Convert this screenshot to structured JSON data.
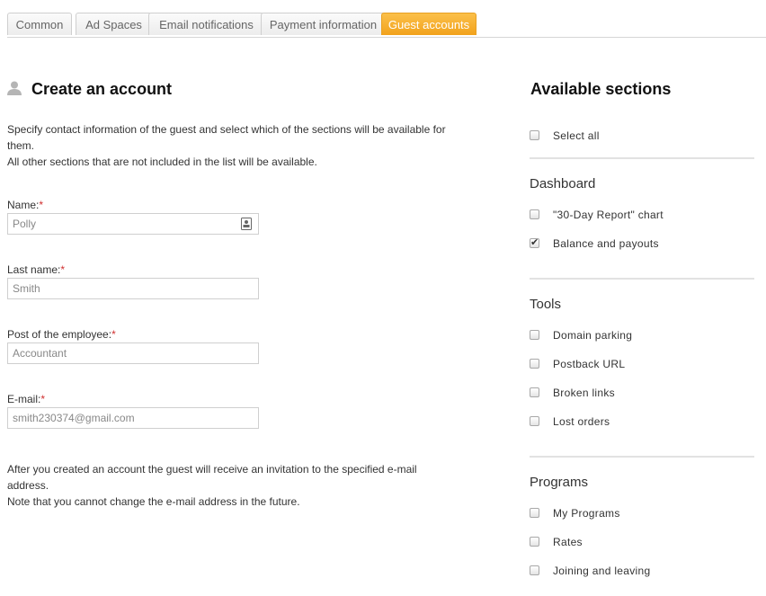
{
  "tabs": [
    {
      "label": "Common"
    },
    {
      "label": "Ad Spaces"
    },
    {
      "label": "Email notifications"
    },
    {
      "label": "Payment information"
    },
    {
      "label": "Guest accounts"
    }
  ],
  "active_tab": "Guest accounts",
  "create": {
    "title": "Create an account",
    "description_line1": "Specify contact information of the guest and select which of the sections will be available for them.",
    "description_line2": "All other sections that are not included in the list will be available."
  },
  "form": {
    "name_label": "Name:",
    "name_value": "Polly",
    "last_name_label": "Last name:",
    "last_name_value": "Smith",
    "post_label": "Post of the employee:",
    "post_value": "Accountant",
    "email_label": "E-mail:",
    "email_value": "smith230374@gmail.com",
    "required_mark": "*"
  },
  "note": {
    "line1": "After you created an account the guest will receive an invitation to the specified e-mail address.",
    "line2": "Note that you cannot change the e-mail address in the future."
  },
  "sections": {
    "title": "Available sections",
    "select_all": {
      "label": "Select all",
      "checked": false
    },
    "dashboard": {
      "title": "Dashboard",
      "items": [
        {
          "label": "\"30-Day Report\" chart",
          "checked": false
        },
        {
          "label": "Balance and payouts",
          "checked": true
        }
      ]
    },
    "tools": {
      "title": "Tools",
      "items": [
        {
          "label": "Domain parking",
          "checked": false
        },
        {
          "label": "Postback URL",
          "checked": false
        },
        {
          "label": "Broken links",
          "checked": false
        },
        {
          "label": "Lost orders",
          "checked": false
        }
      ]
    },
    "programs": {
      "title": "Programs",
      "items": [
        {
          "label": "My Programs",
          "checked": false
        },
        {
          "label": "Rates",
          "checked": false
        },
        {
          "label": "Joining and leaving",
          "checked": false
        }
      ]
    }
  },
  "colors": {
    "active_tab": "#f5a623",
    "required": "#d03030"
  }
}
